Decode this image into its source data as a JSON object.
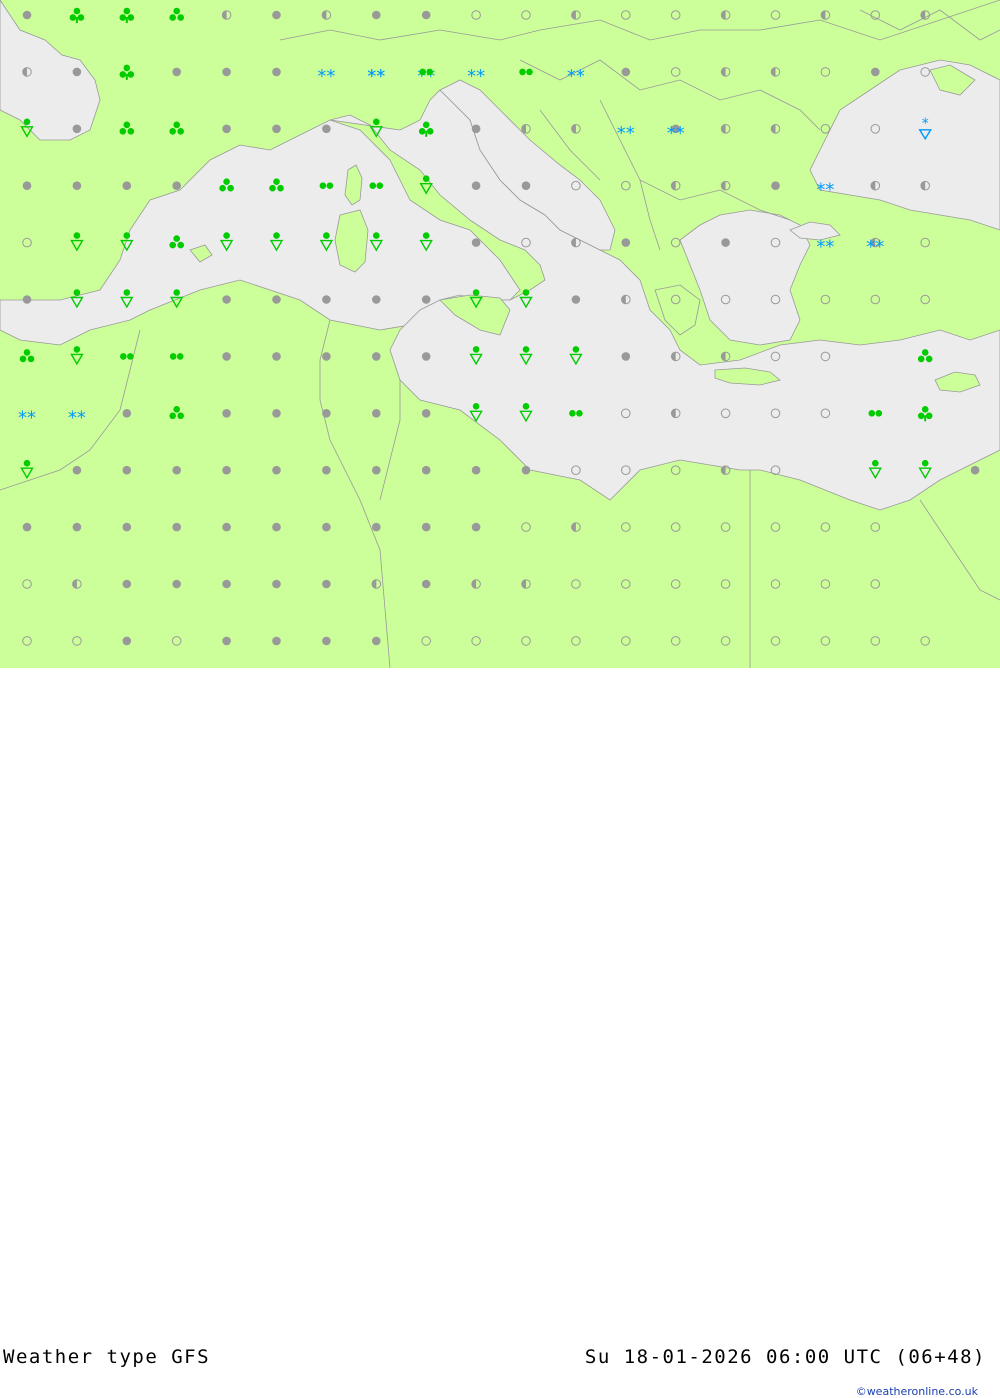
{
  "footer": {
    "title": "Weather type  GFS",
    "datetime": "Su 18-01-2026 06:00 UTC (06+48)",
    "credit": "©weatheronline.co.uk"
  },
  "colors": {
    "land": "#ccff99",
    "sea": "#ececec",
    "border": "#999999",
    "dot": "#999999",
    "rain": "#00cc00",
    "snow": "#0099ff"
  },
  "symbol_legend": {
    "d": "dry-dot",
    "c": "cloudy-ring",
    "h": "half-cloud",
    "r": "light-rain",
    "R": "moderate-rain",
    "T": "rain-showers",
    "S": "snow-showers",
    "s": "light-snow",
    "x": "heavy-snow",
    "a": "rain-and-snow-showers",
    "b": "thundery-showers"
  },
  "grid": {
    "rows": [
      "dbbxhdhddcchcchchch",
      "hdbddd ss rsdchhcdc",
      "TdxxdddTbdhhsdhhccS",
      "dddd xrrRddcchhd hh",
      "cTTaRRRRTdchdcdc hc",
      "dTTTdddddTTdhcccccc",
      "aTrrdddddTTTdhhcc x",
      "s dadddddTTrchcccrb",
      "Tddddddddddccchc TTd",
      "ddddddddddchcccccc",
      "chdddddhdhhccccccc",
      "ccdcddddccccccccccc"
    ],
    "special": {
      "1": {
        "6": "ss",
        "7": "ss",
        "8": "rr",
        "9": "ss"
      },
      "2": {
        "13": "ss"
      },
      "3": {
        "4": "x",
        "16": "ss"
      },
      "4": {
        "16": "ss",
        "17": "ss"
      },
      "7": {
        "1": "ss"
      }
    }
  }
}
